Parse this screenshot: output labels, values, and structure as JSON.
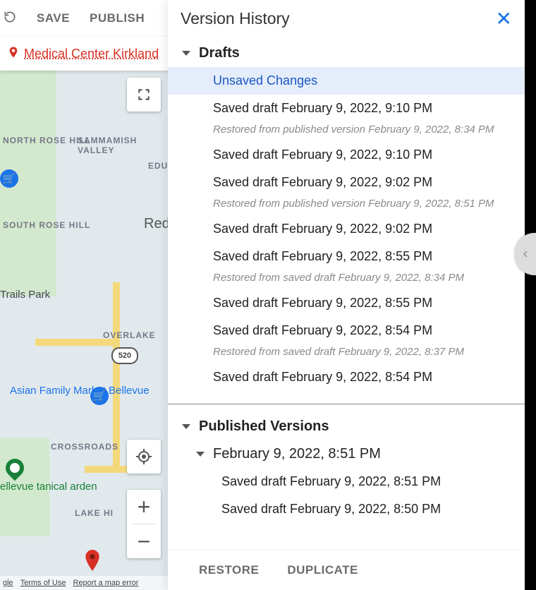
{
  "toolbar": {
    "save": "SAVE",
    "publish": "PUBLISH"
  },
  "location": {
    "name": "Medical Center Kirkland"
  },
  "map": {
    "labels": {
      "north_rose_hill": "NORTH ROSE HILL",
      "sammamish_valley": "SAMMAMISH VALLEY",
      "edu": "EDU",
      "south_rose_hill": "SOUTH ROSE HILL",
      "redmond": "Redn",
      "trails_park": "Trails Park",
      "overlake": "OVERLAKE",
      "lake_hills": "LAKE HI",
      "crossroads": "CROSSROADS",
      "hwy520": "520"
    },
    "pois": {
      "asian_market": "Asian Family Market Bellevue",
      "bellevue_garden": "ellevue tanical arden"
    },
    "footer": {
      "google": "gle",
      "terms": "Terms of Use",
      "report": "Report a map error"
    }
  },
  "panel": {
    "title": "Version History",
    "drafts_heading": "Drafts",
    "drafts": [
      {
        "label": "Unsaved Changes",
        "selected": true
      },
      {
        "label": "Saved draft February 9, 2022, 9:10 PM",
        "note": "Restored from published version February 9, 2022, 8:34 PM"
      },
      {
        "label": "Saved draft February 9, 2022, 9:10 PM"
      },
      {
        "label": "Saved draft February 9, 2022, 9:02 PM",
        "note": "Restored from published version February 9, 2022, 8:51 PM"
      },
      {
        "label": "Saved draft February 9, 2022, 9:02 PM"
      },
      {
        "label": "Saved draft February 9, 2022, 8:55 PM",
        "note": "Restored from saved draft February 9, 2022, 8:34 PM"
      },
      {
        "label": "Saved draft February 9, 2022, 8:55 PM"
      },
      {
        "label": "Saved draft February 9, 2022, 8:54 PM",
        "note": "Restored from saved draft February 9, 2022, 8:37 PM"
      },
      {
        "label": "Saved draft February 9, 2022, 8:54 PM"
      }
    ],
    "published_heading": "Published Versions",
    "published": {
      "group_label": "February 9, 2022, 8:51 PM",
      "items": [
        "Saved draft February 9, 2022, 8:51 PM",
        "Saved draft February 9, 2022, 8:50 PM"
      ]
    },
    "footer": {
      "restore": "RESTORE",
      "duplicate": "DUPLICATE"
    }
  }
}
